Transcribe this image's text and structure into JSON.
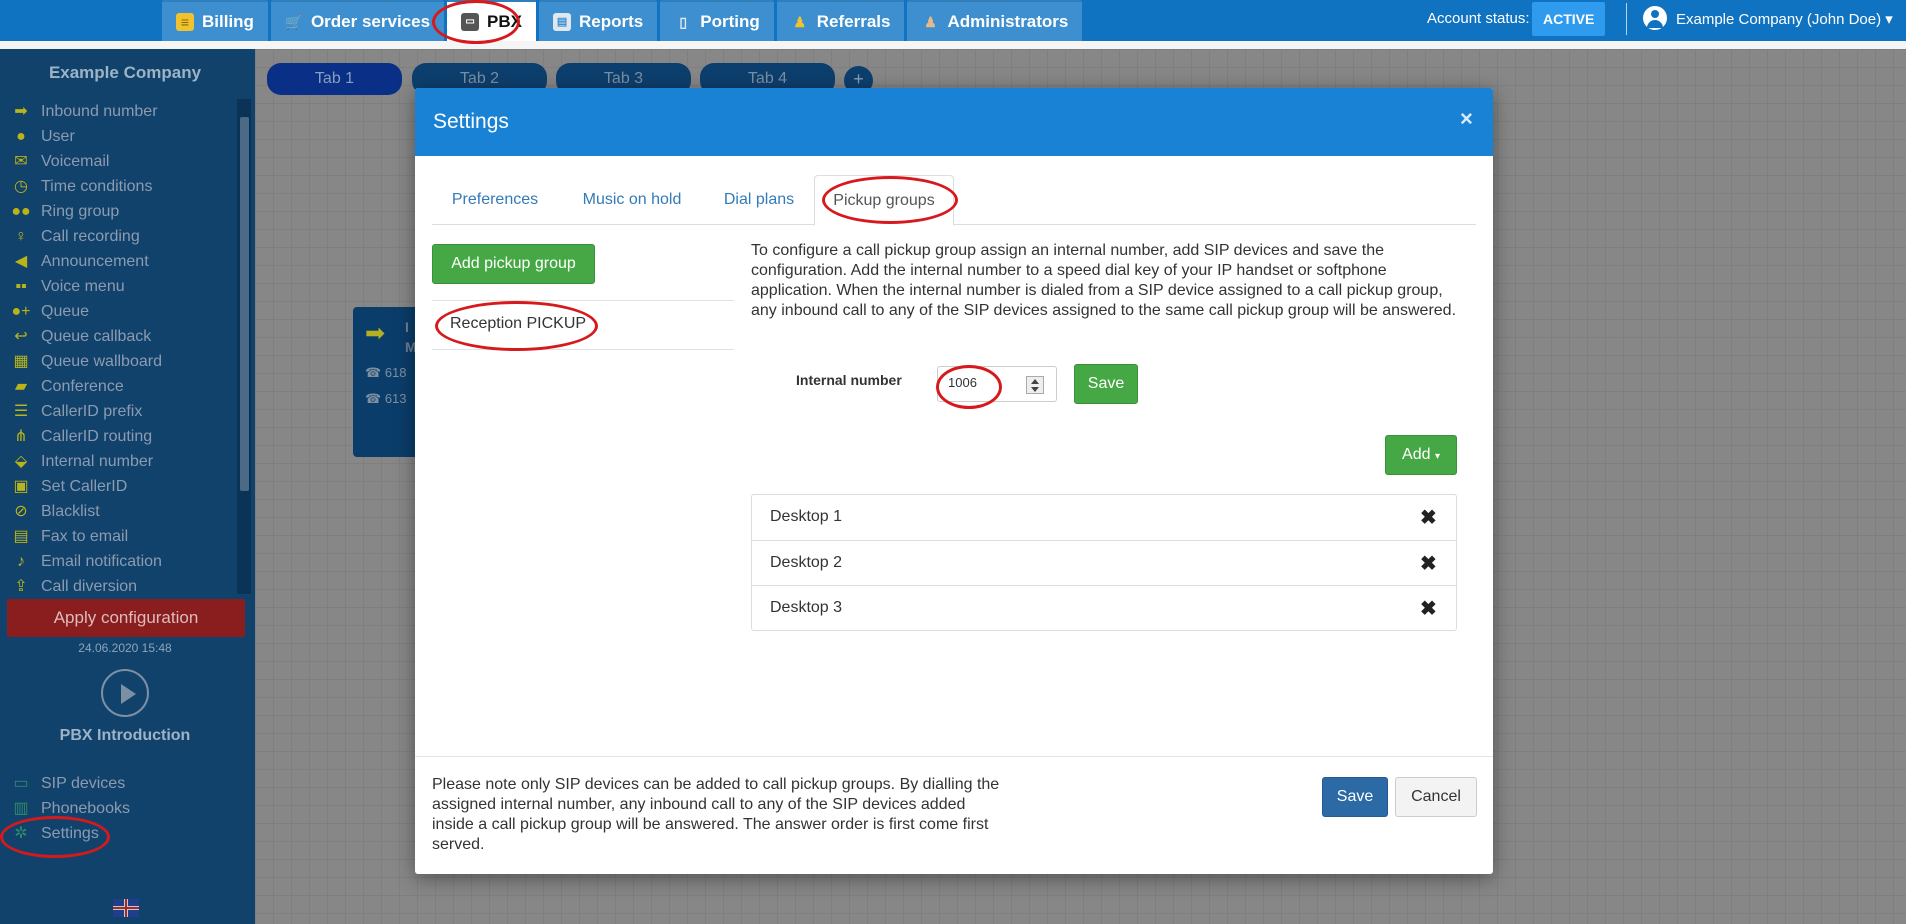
{
  "topnav": {
    "tabs": [
      {
        "label": "Billing",
        "icon": "coins-icon",
        "active": false
      },
      {
        "label": "Order services",
        "icon": "cart-icon",
        "active": false
      },
      {
        "label": "PBX",
        "icon": "pbx-icon",
        "active": true
      },
      {
        "label": "Reports",
        "icon": "reports-icon",
        "active": false
      },
      {
        "label": "Porting",
        "icon": "porting-icon",
        "active": false
      },
      {
        "label": "Referrals",
        "icon": "referrals-icon",
        "active": false
      },
      {
        "label": "Administrators",
        "icon": "admin-icon",
        "active": false
      }
    ],
    "account_status_label": "Account status:",
    "account_status_value": "ACTIVE",
    "user_name": "Example Company (John Doe)"
  },
  "sidebar": {
    "company": "Example Company",
    "items": [
      {
        "label": "Inbound number",
        "icon": "arrow-right-icon"
      },
      {
        "label": "User",
        "icon": "user-icon"
      },
      {
        "label": "Voicemail",
        "icon": "envelope-icon"
      },
      {
        "label": "Time conditions",
        "icon": "clock-icon"
      },
      {
        "label": "Ring group",
        "icon": "users-icon"
      },
      {
        "label": "Call recording",
        "icon": "microphone-icon"
      },
      {
        "label": "Announcement",
        "icon": "bullhorn-icon"
      },
      {
        "label": "Voice menu",
        "icon": "grid-icon"
      },
      {
        "label": "Queue",
        "icon": "user-plus-icon"
      },
      {
        "label": "Queue callback",
        "icon": "reply-icon"
      },
      {
        "label": "Queue wallboard",
        "icon": "table-icon"
      },
      {
        "label": "Conference",
        "icon": "comments-icon"
      },
      {
        "label": "CallerID prefix",
        "icon": "list-icon"
      },
      {
        "label": "CallerID routing",
        "icon": "sitemap-icon"
      },
      {
        "label": "Internal number",
        "icon": "map-marker-icon"
      },
      {
        "label": "Set CallerID",
        "icon": "id-card-icon"
      },
      {
        "label": "Blacklist",
        "icon": "ban-icon"
      },
      {
        "label": "Fax to email",
        "icon": "fax-icon"
      },
      {
        "label": "Email notification",
        "icon": "bell-icon"
      },
      {
        "label": "Call diversion",
        "icon": "upload-icon"
      }
    ],
    "apply_label": "Apply configuration",
    "apply_date": "24.06.2020 15:48",
    "intro_label": "PBX Introduction",
    "bottom_items": [
      {
        "label": "SIP devices",
        "icon": "monitor-icon"
      },
      {
        "label": "Phonebooks",
        "icon": "book-icon"
      },
      {
        "label": "Settings",
        "icon": "gear-icon"
      }
    ]
  },
  "canvas": {
    "tabs": [
      "Tab 1",
      "Tab 2",
      "Tab 3",
      "Tab 4"
    ],
    "add_tab": "+",
    "node": {
      "title_line1": "I",
      "title_line2": "M",
      "phone1": "618",
      "phone2": "613"
    }
  },
  "modal": {
    "title": "Settings",
    "close": "×",
    "tabs": [
      "Preferences",
      "Music on hold",
      "Dial plans",
      "Pickup groups"
    ],
    "add_pickup_label": "Add pickup group",
    "pickup_groups": [
      "Reception PICKUP"
    ],
    "description": "To configure a call pickup group assign an internal number, add SIP devices and save the configuration. Add the internal number to a speed dial key of your IP handset or softphone application. When the internal number is dialed from a SIP device assigned to a call pickup group, any inbound call to any of the SIP devices assigned to the same call pickup group will be answered.",
    "internal_number_label": "Internal number",
    "internal_number_value": "1006",
    "save_small": "Save",
    "add_label": "Add",
    "devices": [
      "Desktop 1",
      "Desktop 2",
      "Desktop 3"
    ],
    "delete_glyph": "✖",
    "footer_note": "Please note only SIP devices can be added to call pickup groups. By dialling the assigned internal number, any inbound call to any of the SIP devices added inside a call pickup group will be answered. The answer order is first come first served.",
    "save_label": "Save",
    "cancel_label": "Cancel"
  },
  "colors": {
    "topbar": "#0f73c2",
    "sidebar": "#11426b",
    "modal_header": "#1a82d4",
    "green_button": "#45a845",
    "primary_button": "#2c6aa5",
    "highlight": "#d6191c"
  }
}
